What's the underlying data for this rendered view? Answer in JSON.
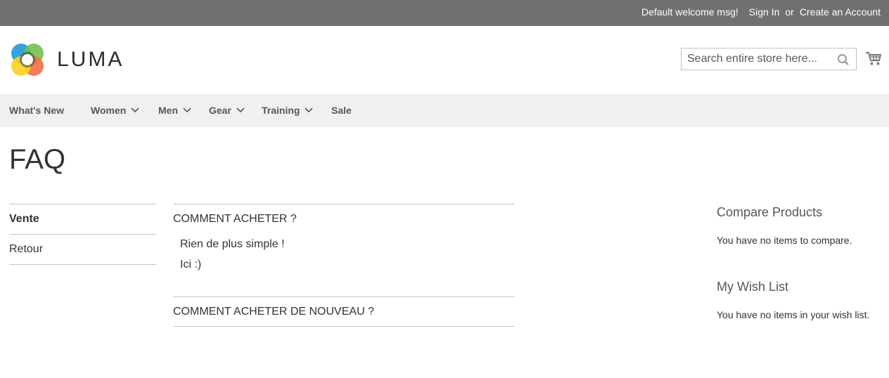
{
  "header": {
    "welcome": "Default welcome msg!",
    "sign_in": "Sign In",
    "or": "or",
    "create_account": "Create an Account",
    "brand": "LUMA"
  },
  "search": {
    "placeholder": "Search entire store here...",
    "icon": "search-icon"
  },
  "cart": {
    "icon": "cart-icon"
  },
  "nav": {
    "items": [
      {
        "label": "What's New",
        "has_dropdown": false
      },
      {
        "label": "Women",
        "has_dropdown": true
      },
      {
        "label": "Men",
        "has_dropdown": true
      },
      {
        "label": "Gear",
        "has_dropdown": true
      },
      {
        "label": "Training",
        "has_dropdown": true
      },
      {
        "label": "Sale",
        "has_dropdown": false
      }
    ]
  },
  "page": {
    "title": "FAQ"
  },
  "faq_categories": [
    {
      "label": "Vente",
      "active": true
    },
    {
      "label": "Retour",
      "active": false
    }
  ],
  "faq_items": [
    {
      "question": "COMMENT ACHETER ?",
      "answer_lines": [
        "Rien de plus simple !",
        "Ici :)"
      ],
      "expanded": true
    },
    {
      "question": "COMMENT ACHETER DE NOUVEAU ?",
      "expanded": false
    }
  ],
  "sidebar": {
    "compare_title": "Compare Products",
    "compare_text": "You have no items to compare.",
    "wishlist_title": "My Wish List",
    "wishlist_text": "You have no items in your wish list."
  },
  "colors": {
    "topbar": "#6e716e",
    "nav_bg": "#f0f0f0",
    "text": "#333333"
  }
}
